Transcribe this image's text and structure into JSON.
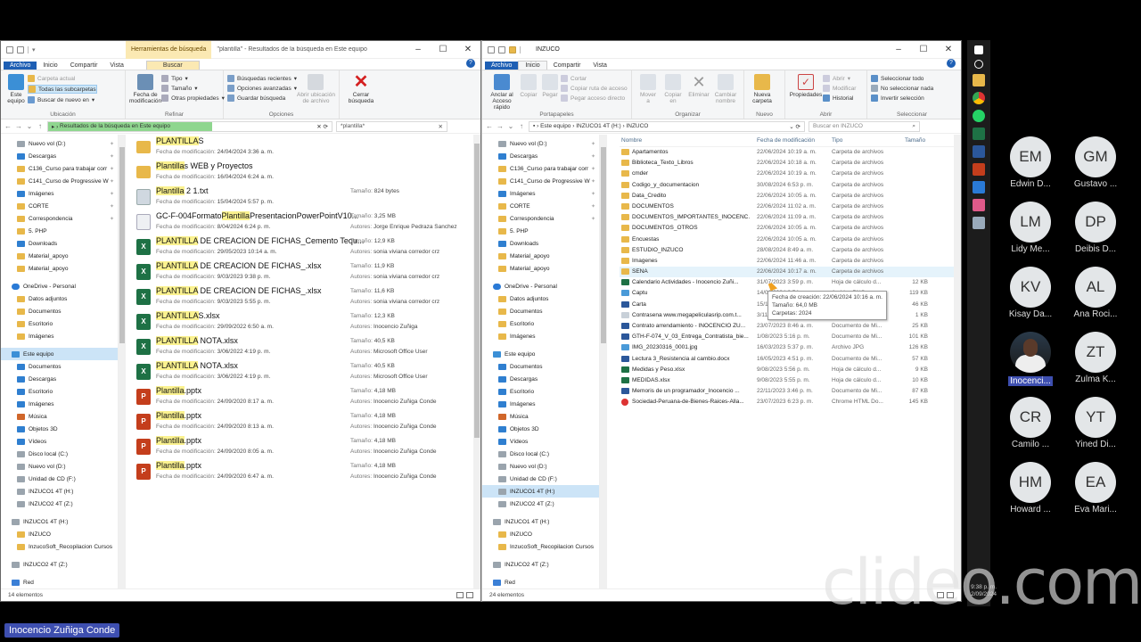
{
  "window1": {
    "title": "\"plantilla\" - Resultados de la búsqueda en Este equipo",
    "context_tab": "Herramientas de búsqueda",
    "tabs": [
      "Archivo",
      "Inicio",
      "Compartir",
      "Vista",
      "Buscar"
    ],
    "ribbon": {
      "este_equipo": "Este\nequipo",
      "carpeta_actual": "Carpeta actual",
      "todas_subcarpetas": "Todas las subcarpetas",
      "buscar_de_nuevo": "Buscar de nuevo en",
      "ubicacion": "Ubicación",
      "fecha_mod": "Fecha de\nmodificación",
      "tipo": "Tipo",
      "tamano": "Tamaño",
      "otras_prop": "Otras propiedades",
      "refinar": "Refinar",
      "busquedas_recientes": "Búsquedas recientes",
      "opciones_avanzadas": "Opciones avanzadas",
      "guardar_busqueda": "Guardar búsqueda",
      "abrir_ubicacion": "Abrir ubicación\nde archivo",
      "opciones": "Opciones",
      "cerrar_busqueda": "Cerrar\nbúsqueda"
    },
    "address": "Resultados de la búsqueda en Este equipo",
    "search_value": "*plantilla*",
    "nav": [
      {
        "label": "Nuevo vol (D:)",
        "icon": "drive",
        "pin": true
      },
      {
        "label": "Descargas",
        "icon": "blue",
        "pin": true
      },
      {
        "label": "C136_Curso para trabajar corr",
        "icon": "folder",
        "pin": true
      },
      {
        "label": "C141_Curso de Progressive W",
        "icon": "folder",
        "pin": true
      },
      {
        "label": "Imágenes",
        "icon": "blue",
        "pin": true
      },
      {
        "label": "CORTE",
        "icon": "folder",
        "pin": true
      },
      {
        "label": "Correspondencia",
        "icon": "folder",
        "pin": true
      },
      {
        "label": "5. PHP",
        "icon": "folder",
        "pin": false
      },
      {
        "label": "Downloads",
        "icon": "blue",
        "pin": false
      },
      {
        "label": "Material_apoyo",
        "icon": "folder",
        "pin": false
      },
      {
        "label": "Material_apoyo",
        "icon": "folder",
        "pin": false
      },
      {
        "label": "",
        "icon": "",
        "pin": false
      },
      {
        "label": "OneDrive - Personal",
        "icon": "cloud",
        "pin": false
      },
      {
        "label": "Datos adjuntos",
        "icon": "folder",
        "pin": false
      },
      {
        "label": "Documentos",
        "icon": "folder",
        "pin": false
      },
      {
        "label": "Escritorio",
        "icon": "folder",
        "pin": false
      },
      {
        "label": "Imágenes",
        "icon": "folder",
        "pin": false
      },
      {
        "label": "",
        "icon": "",
        "pin": false
      },
      {
        "label": "Este equipo",
        "icon": "pc",
        "pin": false,
        "selected": true
      },
      {
        "label": "Documentos",
        "icon": "blue",
        "pin": false
      },
      {
        "label": "Descargas",
        "icon": "blue",
        "pin": false
      },
      {
        "label": "Escritorio",
        "icon": "blue",
        "pin": false
      },
      {
        "label": "Imágenes",
        "icon": "blue",
        "pin": false
      },
      {
        "label": "Música",
        "icon": "music",
        "pin": false
      },
      {
        "label": "Objetos 3D",
        "icon": "blue",
        "pin": false
      },
      {
        "label": "Vídeos",
        "icon": "blue",
        "pin": false
      },
      {
        "label": "Disco local (C:)",
        "icon": "drive",
        "pin": false
      },
      {
        "label": "Nuevo vol (D:)",
        "icon": "drive",
        "pin": false
      },
      {
        "label": "Unidad de CD (F:)",
        "icon": "drive",
        "pin": false
      },
      {
        "label": "INZUCO1 4T (H:)",
        "icon": "drive",
        "pin": false
      },
      {
        "label": "INZUCO2 4T (Z:)",
        "icon": "drive",
        "pin": false
      },
      {
        "label": "",
        "icon": "",
        "pin": false
      },
      {
        "label": "INZUCO1 4T (H:)",
        "icon": "drive",
        "pin": false
      },
      {
        "label": "INZUCO",
        "icon": "folder",
        "pin": false
      },
      {
        "label": "InzucoSoft_Recopilacion Cursos",
        "icon": "folder",
        "pin": false
      },
      {
        "label": "",
        "icon": "",
        "pin": false
      },
      {
        "label": "INZUCO2 4T (Z:)",
        "icon": "drive",
        "pin": false
      },
      {
        "label": "",
        "icon": "",
        "pin": false
      },
      {
        "label": "Red",
        "icon": "net",
        "pin": false
      }
    ],
    "fecha_label": "Fecha de modificación: ",
    "tamano_label": "Tamaño: ",
    "autores_label": "Autores: ",
    "results": [
      {
        "pre": "",
        "hl": "PLANTILLA",
        "post": "S",
        "icon": "folder",
        "date": "24/04/2024 3:36 a. m.",
        "size": "",
        "author": ""
      },
      {
        "pre": "",
        "hl": "Plantilla",
        "post": "s WEB y Proyectos",
        "icon": "folder",
        "date": "16/04/2024 6:24 a. m.",
        "size": "",
        "author": ""
      },
      {
        "pre": "",
        "hl": "Plantilla",
        "post": " 2 1.txt",
        "icon": "txt",
        "date": "15/04/2024 5:57 p. m.",
        "size": "824 bytes",
        "author": ""
      },
      {
        "pre": "GC-F-004Formato",
        "hl": "Plantilla",
        "post": "PresentacionPowerPointV10...",
        "icon": "doc",
        "date": "8/04/2024 6:24 p. m.",
        "size": "3,25 MB",
        "author": "Jorge Enrique Pedraza Sanchez"
      },
      {
        "pre": "",
        "hl": "PLANTILLA",
        "post": " DE CREACION DE FICHAS_Cemento Tequ...",
        "icon": "xl",
        "date": "29/05/2023 10:14 a. m.",
        "size": "12,9 KB",
        "author": "sonia viviana corredor crz"
      },
      {
        "pre": "",
        "hl": "PLANTILLA",
        "post": " DE CREACION DE FICHAS_.xlsx",
        "icon": "xl",
        "date": "9/03/2023 9:38 p. m.",
        "size": "11,9 KB",
        "author": "sonia viviana corredor crz"
      },
      {
        "pre": "",
        "hl": "PLANTILLA",
        "post": " DE CREACION DE FICHAS_.xlsx",
        "icon": "xl",
        "date": "9/03/2023 5:55 p. m.",
        "size": "11,6 KB",
        "author": "sonia viviana corredor crz"
      },
      {
        "pre": "",
        "hl": "PLANTILLA",
        "post": "S.xlsx",
        "icon": "xl",
        "date": "29/09/2022 6:50 a. m.",
        "size": "12,3 KB",
        "author": "Inocencio Zuñiga"
      },
      {
        "pre": "",
        "hl": "PLANTILLA",
        "post": " NOTA.xlsx",
        "icon": "xl",
        "date": "3/06/2022 4:19 p. m.",
        "size": "40,5 KB",
        "author": "Microsoft Office User"
      },
      {
        "pre": "",
        "hl": "PLANTILLA",
        "post": " NOTA.xlsx",
        "icon": "xl",
        "date": "3/06/2022 4:19 p. m.",
        "size": "40,5 KB",
        "author": "Microsoft Office User"
      },
      {
        "pre": "",
        "hl": "Plantilla",
        "post": ".pptx",
        "icon": "pp",
        "date": "24/09/2020 8:17 a. m.",
        "size": "4,18 MB",
        "author": "Inocencio Zuñiga Conde"
      },
      {
        "pre": "",
        "hl": "Plantilla",
        "post": ".pptx",
        "icon": "pp",
        "date": "24/09/2020 8:13 a. m.",
        "size": "4,18 MB",
        "author": "Inocencio Zuñiga Conde"
      },
      {
        "pre": "",
        "hl": "Plantilla",
        "post": ".pptx",
        "icon": "pp",
        "date": "24/09/2020 8:05 a. m.",
        "size": "4,18 MB",
        "author": "Inocencio Zuñiga Conde"
      },
      {
        "pre": "",
        "hl": "Plantilla",
        "post": ".pptx",
        "icon": "pp",
        "date": "24/09/2020 6:47 a. m.",
        "size": "4,18 MB",
        "author": "Inocencio Zuñiga Conde"
      }
    ],
    "status": "14 elementos"
  },
  "window2": {
    "title": "INZUCO",
    "tabs": [
      "Archivo",
      "Inicio",
      "Compartir",
      "Vista"
    ],
    "ribbon": {
      "anclar": "Anclar al\nAcceso rápido",
      "copiar": "Copiar",
      "pegar": "Pegar",
      "cortar": "Cortar",
      "copiar_ruta": "Copiar ruta de acceso",
      "pegar_acceso": "Pegar acceso directo",
      "portapapeles": "Portapapeles",
      "mover": "Mover\na",
      "copiar_en": "Copiar\nen",
      "eliminar": "Eliminar",
      "cambiar_nombre": "Cambiar\nnombre",
      "organizar": "Organizar",
      "nueva_carpeta": "Nueva\ncarpeta",
      "nuevo": "Nuevo",
      "propiedades": "Propiedades",
      "abrir": "Abrir",
      "modificar": "Modificar",
      "historial": "Historial",
      "abrir_g": "Abrir",
      "sel_todo": "Seleccionar todo",
      "no_sel": "No seleccionar nada",
      "invertir": "Invertir selección",
      "seleccionar": "Seleccionar"
    },
    "address": [
      "Este equipo",
      "INZUCO1 4T (H:)",
      "INZUCO"
    ],
    "search_placeholder": "Buscar en INZUCO",
    "columns": [
      "Nombre",
      "Fecha de modificación",
      "Tipo",
      "Tamaño"
    ],
    "nav": [
      {
        "label": "Nuevo vol (D:)",
        "icon": "drive",
        "pin": true
      },
      {
        "label": "Descargas",
        "icon": "blue",
        "pin": true
      },
      {
        "label": "C136_Curso para trabajar corr",
        "icon": "folder",
        "pin": true
      },
      {
        "label": "C141_Curso de Progressive W",
        "icon": "folder",
        "pin": true
      },
      {
        "label": "Imágenes",
        "icon": "blue",
        "pin": true
      },
      {
        "label": "CORTE",
        "icon": "folder",
        "pin": true
      },
      {
        "label": "Correspondencia",
        "icon": "folder",
        "pin": true
      },
      {
        "label": "5. PHP",
        "icon": "folder",
        "pin": false
      },
      {
        "label": "Downloads",
        "icon": "blue",
        "pin": false
      },
      {
        "label": "Material_apoyo",
        "icon": "folder",
        "pin": false
      },
      {
        "label": "Material_apoyo",
        "icon": "folder",
        "pin": false
      },
      {
        "label": "",
        "icon": "",
        "pin": false
      },
      {
        "label": "OneDrive - Personal",
        "icon": "cloud",
        "pin": false
      },
      {
        "label": "Datos adjuntos",
        "icon": "folder",
        "pin": false
      },
      {
        "label": "Documentos",
        "icon": "folder",
        "pin": false
      },
      {
        "label": "Escritorio",
        "icon": "folder",
        "pin": false
      },
      {
        "label": "Imágenes",
        "icon": "folder",
        "pin": false
      },
      {
        "label": "",
        "icon": "",
        "pin": false
      },
      {
        "label": "Este equipo",
        "icon": "pc",
        "pin": false
      },
      {
        "label": "Documentos",
        "icon": "blue",
        "pin": false
      },
      {
        "label": "Descargas",
        "icon": "blue",
        "pin": false
      },
      {
        "label": "Escritorio",
        "icon": "blue",
        "pin": false
      },
      {
        "label": "Imágenes",
        "icon": "blue",
        "pin": false
      },
      {
        "label": "Música",
        "icon": "music",
        "pin": false
      },
      {
        "label": "Objetos 3D",
        "icon": "blue",
        "pin": false
      },
      {
        "label": "Vídeos",
        "icon": "blue",
        "pin": false
      },
      {
        "label": "Disco local (C:)",
        "icon": "drive",
        "pin": false
      },
      {
        "label": "Nuevo vol (D:)",
        "icon": "drive",
        "pin": false
      },
      {
        "label": "Unidad de CD (F:)",
        "icon": "drive",
        "pin": false
      },
      {
        "label": "INZUCO1 4T (H:)",
        "icon": "drive",
        "pin": false,
        "selected": true
      },
      {
        "label": "INZUCO2 4T (Z:)",
        "icon": "drive",
        "pin": false
      },
      {
        "label": "",
        "icon": "",
        "pin": false
      },
      {
        "label": "INZUCO1 4T (H:)",
        "icon": "drive",
        "pin": false
      },
      {
        "label": "INZUCO",
        "icon": "folder",
        "pin": false
      },
      {
        "label": "InzucoSoft_Recopilacion Cursos",
        "icon": "folder",
        "pin": false
      },
      {
        "label": "",
        "icon": "",
        "pin": false
      },
      {
        "label": "INZUCO2 4T (Z:)",
        "icon": "drive",
        "pin": false
      },
      {
        "label": "",
        "icon": "",
        "pin": false
      },
      {
        "label": "Red",
        "icon": "net",
        "pin": false
      }
    ],
    "files": [
      {
        "name": "Apartamentos",
        "date": "22/06/2024 10:19 a. m.",
        "type": "Carpeta de archivos",
        "size": "",
        "icon": "folder"
      },
      {
        "name": "Biblioteca_Texto_Libros",
        "date": "22/06/2024 10:18 a. m.",
        "type": "Carpeta de archivos",
        "size": "",
        "icon": "folder"
      },
      {
        "name": "cmder",
        "date": "22/06/2024 10:19 a. m.",
        "type": "Carpeta de archivos",
        "size": "",
        "icon": "folder"
      },
      {
        "name": "Codigo_y_documentacion",
        "date": "30/08/2024 6:53 p. m.",
        "type": "Carpeta de archivos",
        "size": "",
        "icon": "folder"
      },
      {
        "name": "Data_Credito",
        "date": "22/06/2024 10:05 a. m.",
        "type": "Carpeta de archivos",
        "size": "",
        "icon": "folder"
      },
      {
        "name": "DOCUMENTOS",
        "date": "22/06/2024 11:02 a. m.",
        "type": "Carpeta de archivos",
        "size": "",
        "icon": "folder"
      },
      {
        "name": "DOCUMENTOS_IMPORTANTES_INOCENC...",
        "date": "22/06/2024 11:09 a. m.",
        "type": "Carpeta de archivos",
        "size": "",
        "icon": "folder"
      },
      {
        "name": "DOCUMENTOS_OTROS",
        "date": "22/06/2024 10:05 a. m.",
        "type": "Carpeta de archivos",
        "size": "",
        "icon": "folder"
      },
      {
        "name": "Encuestas",
        "date": "22/06/2024 10:05 a. m.",
        "type": "Carpeta de archivos",
        "size": "",
        "icon": "folder"
      },
      {
        "name": "ESTUDIO_INZUCO",
        "date": "28/08/2024 8:49 a. m.",
        "type": "Carpeta de archivos",
        "size": "",
        "icon": "folder"
      },
      {
        "name": "Imagenes",
        "date": "22/06/2024 11:46 a. m.",
        "type": "Carpeta de archivos",
        "size": "",
        "icon": "folder"
      },
      {
        "name": "SENA",
        "date": "22/06/2024 10:17 a. m.",
        "type": "Carpeta de archivos",
        "size": "",
        "icon": "folder",
        "hover": true
      },
      {
        "name": "Calendario Actividades - Inocencio Zuñi...",
        "date": "31/07/2023 3:59 p. m.",
        "type": "Hoja de cálculo d...",
        "size": "12 KB",
        "icon": "xl"
      },
      {
        "name": "Captu",
        "date": "14/01/2024 2:54 p. m.",
        "type": "Archivo PNG",
        "size": "119 KB",
        "icon": "img"
      },
      {
        "name": "Carta",
        "date": "15/11/2023 6:29 a. m.",
        "type": "Documento de Mi...",
        "size": "46 KB",
        "icon": "doc"
      },
      {
        "name": "Contrasena www.megapeliculasrip.com.t...",
        "date": "3/11/2020 7:51 p. m.",
        "type": "Archivo TXT",
        "size": "1 KB",
        "icon": "txt"
      },
      {
        "name": "Contrato arrendamiento - INOCENCIO ZU...",
        "date": "23/07/2023 8:46 a. m.",
        "type": "Documento de Mi...",
        "size": "25 KB",
        "icon": "doc"
      },
      {
        "name": "GTH-F-074_V_03_Entrega_Contratista_bie...",
        "date": "1/08/2023 5:16 p. m.",
        "type": "Documento de Mi...",
        "size": "101 KB",
        "icon": "doc"
      },
      {
        "name": "IMG_20230316_0001.jpg",
        "date": "16/03/2023 5:37 p. m.",
        "type": "Archivo JPG",
        "size": "126 KB",
        "icon": "img"
      },
      {
        "name": "Lectura 3_Resistencia al cambio.docx",
        "date": "16/05/2023 4:51 p. m.",
        "type": "Documento de Mi...",
        "size": "57 KB",
        "icon": "doc"
      },
      {
        "name": "Medidas y Peso.xlsx",
        "date": "9/08/2023 5:56 p. m.",
        "type": "Hoja de cálculo d...",
        "size": "9 KB",
        "icon": "xl"
      },
      {
        "name": "MEDIDAS.xlsx",
        "date": "9/08/2023 5:55 p. m.",
        "type": "Hoja de cálculo d...",
        "size": "10 KB",
        "icon": "xl"
      },
      {
        "name": "Memoris de un programador_Inocencio ...",
        "date": "22/11/2023 3:46 p. m.",
        "type": "Documento de Mi...",
        "size": "87 KB",
        "icon": "doc"
      },
      {
        "name": "Sociedad-Peruana-de-Bienes-Raices-Alla...",
        "date": "23/07/2023 6:23 p. m.",
        "type": "Chrome HTML Do...",
        "size": "145 KB",
        "icon": "chrome"
      }
    ],
    "tooltip": [
      "Fecha de creación: 22/06/2024 10:16 a. m.",
      "Tamaño: 64,0 MB",
      "Carpetas: 2024"
    ],
    "status": "24 elementos"
  },
  "meeting": {
    "participants": [
      {
        "initials": "EM",
        "name": "Edwin D..."
      },
      {
        "initials": "GM",
        "name": "Gustavo ..."
      },
      {
        "initials": "LM",
        "name": "Lidy Me..."
      },
      {
        "initials": "DP",
        "name": "Deibis D..."
      },
      {
        "initials": "KV",
        "name": "Kisay Da..."
      },
      {
        "initials": "AL",
        "name": "Ana Roci..."
      },
      {
        "initials": "",
        "name": "Inocenci...",
        "photo": true,
        "highlight": true
      },
      {
        "initials": "ZT",
        "name": "Zulma K..."
      },
      {
        "initials": "CR",
        "name": "Camilo ..."
      },
      {
        "initials": "YT",
        "name": "Yined Di..."
      },
      {
        "initials": "HM",
        "name": "Howard ..."
      },
      {
        "initials": "EA",
        "name": "Eva Mari..."
      }
    ],
    "speaker": "Inocencio Zuñiga Conde"
  },
  "clock": {
    "time": "9:38 p. m.",
    "date": "2/09/2024"
  },
  "watermark": "clideo.com",
  "colors": {
    "file_tab": "#1e5fb4",
    "search_tab": "#fbe9b3",
    "highlight": "#fbf28f",
    "excel": "#1e7145",
    "powerpoint": "#c43e1c",
    "folder": "#e8b84a",
    "meet_name_bg": "#3e4fb0"
  }
}
